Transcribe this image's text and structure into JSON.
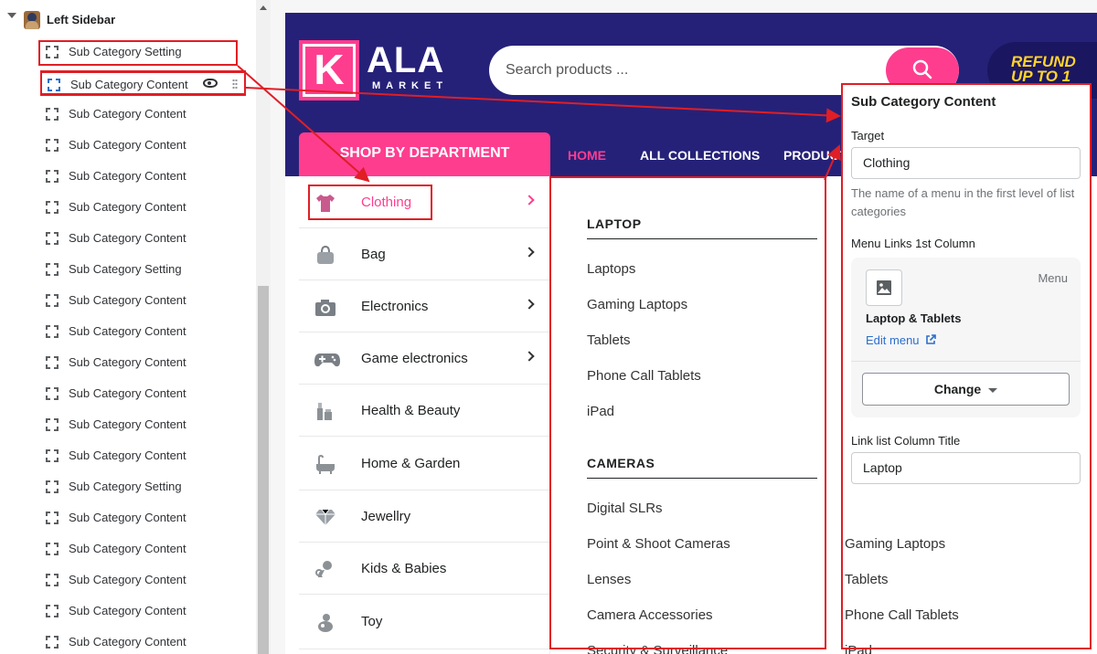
{
  "sidebar": {
    "section_title": "Left Sidebar",
    "blocks": [
      "Sub Category Setting",
      "Sub Category Content",
      "Sub Category Content",
      "Sub Category Content",
      "Sub Category Content",
      "Sub Category Content",
      "Sub Category Content",
      "Sub Category Setting",
      "Sub Category Content",
      "Sub Category Content",
      "Sub Category Content",
      "Sub Category Content",
      "Sub Category Content",
      "Sub Category Content",
      "Sub Category Setting",
      "Sub Category Content",
      "Sub Category Content",
      "Sub Category Content",
      "Sub Category Content",
      "Sub Category Content"
    ]
  },
  "store": {
    "logo_letter": "K",
    "logo_text": "ALA",
    "logo_sub": "MARKET",
    "search_placeholder": "Search products ...",
    "promo": "REFUND UP TO 1",
    "department_tab": "SHOP BY DEPARTMENT",
    "nav": {
      "home": "HOME",
      "collections": "ALL COLLECTIONS",
      "products": "PRODUCTS"
    },
    "departments": [
      {
        "name": "Clothing",
        "icon": "shirt-icon",
        "chevron": true
      },
      {
        "name": "Bag",
        "icon": "bag-icon",
        "chevron": true
      },
      {
        "name": "Electronics",
        "icon": "camera-icon",
        "chevron": true
      },
      {
        "name": "Game electronics",
        "icon": "gamepad-icon",
        "chevron": true
      },
      {
        "name": "Health & Beauty",
        "icon": "cosmetics-icon",
        "chevron": false
      },
      {
        "name": "Home & Garden",
        "icon": "bathtub-icon",
        "chevron": false
      },
      {
        "name": "Jewellry",
        "icon": "diamond-icon",
        "chevron": false
      },
      {
        "name": "Kids & Babies",
        "icon": "baby-icon",
        "chevron": false
      },
      {
        "name": "Toy",
        "icon": "toy-icon",
        "chevron": false
      }
    ],
    "mega": {
      "columns": [
        {
          "title": "LAPTOP",
          "links": [
            "Laptops",
            "Gaming Laptops",
            "Tablets",
            "Phone Call Tablets",
            "iPad"
          ]
        },
        {
          "title": "CAMERAS",
          "links": [
            "Digital SLRs",
            "Point & Shoot Cameras",
            "Lenses",
            "Camera Accessories",
            "Security & Surveillance"
          ]
        }
      ],
      "overflow_links": [
        "Gaming Laptops",
        "Tablets",
        "Phone Call Tablets",
        "iPad"
      ]
    }
  },
  "settings": {
    "title": "Sub Category Content",
    "target_label": "Target",
    "target_value": "Clothing",
    "target_help": "The name of a menu in the first level of list categories",
    "menu_label": "Menu Links 1st Column",
    "menu_type": "Menu",
    "menu_name": "Laptop & Tablets",
    "menu_edit": "Edit menu",
    "menu_change": "Change",
    "column_title_label": "Link list Column Title",
    "column_title_value": "Laptop"
  },
  "colors": {
    "accent_pink": "#ff3d8f",
    "header_navy": "#262178",
    "annotation_red": "#e01e25",
    "link_blue": "#2c6ecb"
  }
}
